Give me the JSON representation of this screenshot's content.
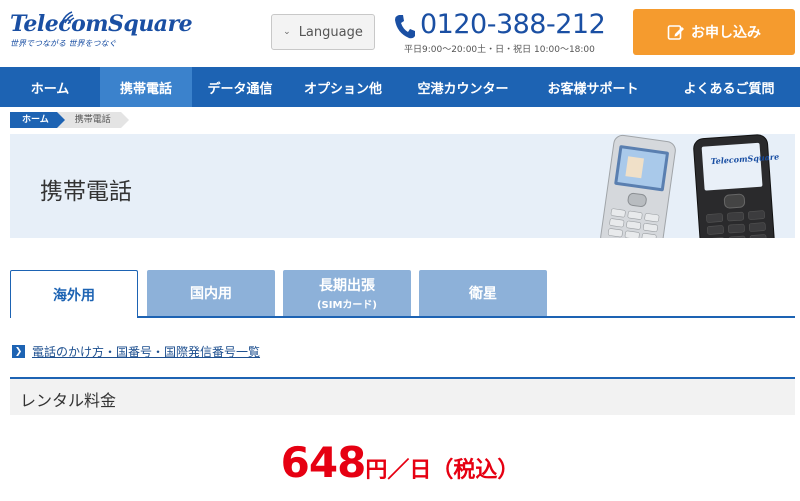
{
  "header": {
    "logo_main": "TelecomSquare",
    "logo_sub": "世界でつながる 世界をつなぐ",
    "language_label": "Language",
    "phone_number": "0120-388-212",
    "phone_hours": "平日9:00〜20:00土・日・祝日 10:00〜18:00",
    "apply_label": "お申し込み"
  },
  "nav": {
    "items": [
      {
        "label": "ホーム"
      },
      {
        "label": "携帯電話"
      },
      {
        "label": "データ通信"
      },
      {
        "label": "オプション他"
      },
      {
        "label": "空港カウンター"
      },
      {
        "label": "お客様サポート"
      },
      {
        "label": "よくあるご質問"
      }
    ],
    "active_index": 1
  },
  "breadcrumb": {
    "home": "ホーム",
    "current": "携帯電話"
  },
  "hero": {
    "title": "携帯電話",
    "phone_brand": "TelecomSquare"
  },
  "tabs": [
    {
      "label": "海外用",
      "sub": ""
    },
    {
      "label": "国内用",
      "sub": ""
    },
    {
      "label": "長期出張",
      "sub": "(SIMカード)"
    },
    {
      "label": "衛星",
      "sub": ""
    }
  ],
  "link": {
    "text": "電話のかけ方・国番号・国際発信番号一覧"
  },
  "section": {
    "title": "レンタル料金"
  },
  "price": {
    "amount": "648",
    "unit": "円／日（税込）"
  },
  "colors": {
    "primary": "#1d63b3",
    "nav_active": "#3b82cc",
    "accent_orange": "#f59b2e",
    "price_red": "#e60012",
    "tab_inactive": "#8db1d9"
  }
}
